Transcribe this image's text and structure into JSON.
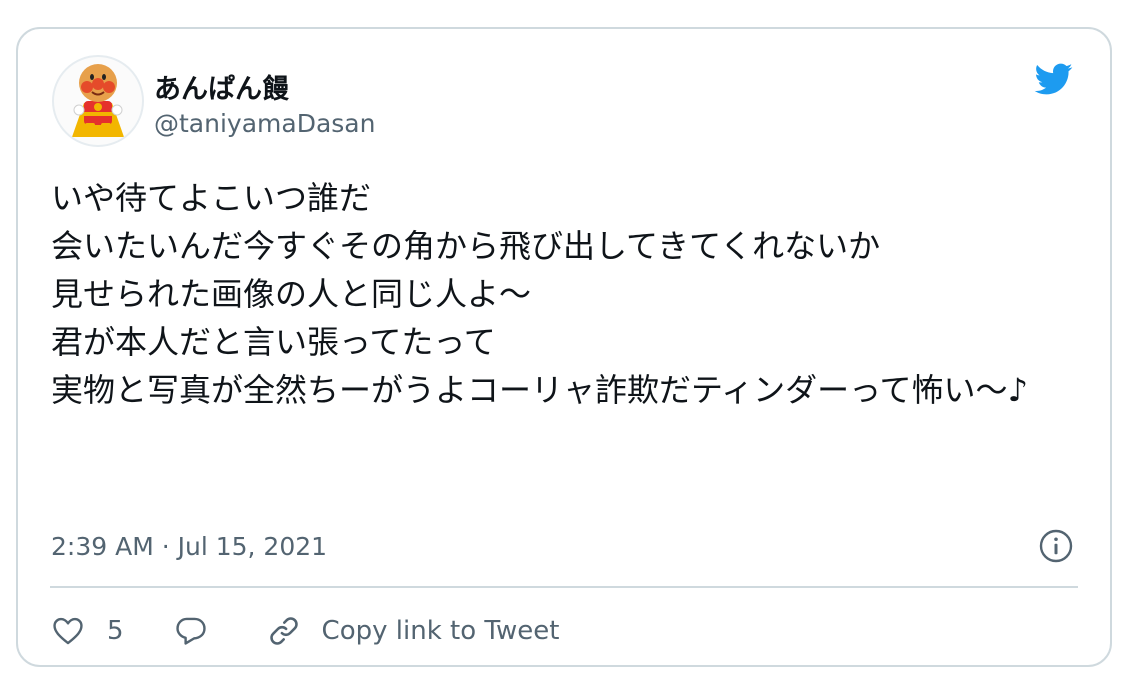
{
  "tweet": {
    "author": {
      "display_name": "あんぱん饅",
      "handle": "@taniyamaDasan",
      "avatar_icon": "anpanman-avatar-icon"
    },
    "lines": [
      "いや待てよこいつ誰だ",
      "会いたいんだ今すぐその角から飛び出してきてくれないか",
      "見せられた画像の人と同じ人よ〜",
      "君が本人だと言い張ってたって",
      "実物と写真が全然ちーがうよコーリャ詐欺だティンダーって怖い〜♪"
    ],
    "timestamp": "2:39 AM · Jul 15, 2021",
    "like_count": "5",
    "copy_link_label": "Copy link to Tweet"
  },
  "icons": {
    "brand": "twitter-bird-icon",
    "info": "info-icon",
    "like": "heart-icon",
    "reply": "reply-bubble-icon",
    "copy": "link-icon"
  },
  "colors": {
    "twitter_blue": "#1d9bf0",
    "secondary_text": "#536471",
    "primary_text": "#0f1419",
    "border": "#cfd9de"
  }
}
